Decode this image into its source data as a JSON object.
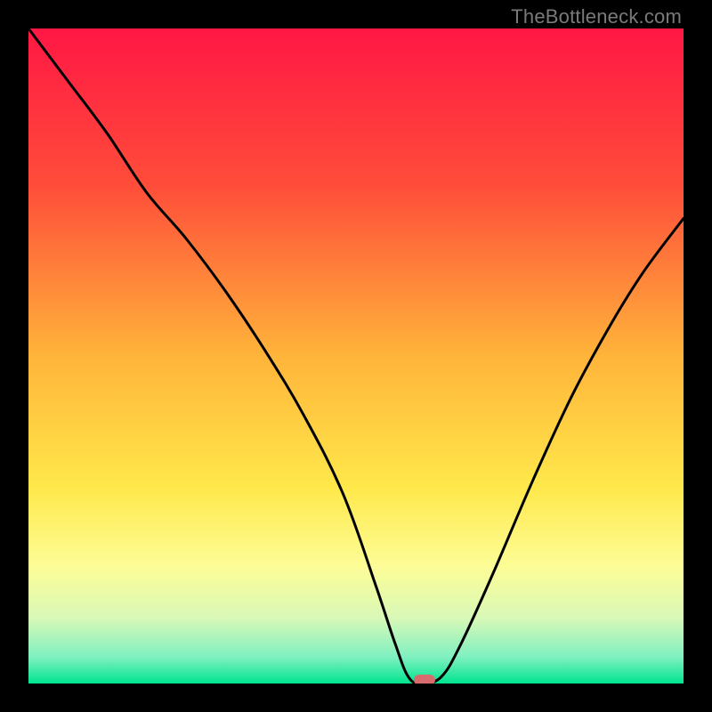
{
  "watermark": "TheBottleneck.com",
  "chart_data": {
    "type": "line",
    "title": "",
    "xlabel": "",
    "ylabel": "",
    "xlim": [
      0,
      100
    ],
    "ylim": [
      0,
      100
    ],
    "gradient_stops": [
      {
        "offset": 0,
        "color": "#ff1744"
      },
      {
        "offset": 0.24,
        "color": "#ff4d3a"
      },
      {
        "offset": 0.5,
        "color": "#ffb43a"
      },
      {
        "offset": 0.7,
        "color": "#ffe84a"
      },
      {
        "offset": 0.82,
        "color": "#fdfd96"
      },
      {
        "offset": 0.9,
        "color": "#d9f8b7"
      },
      {
        "offset": 0.96,
        "color": "#7ef0c0"
      },
      {
        "offset": 1.0,
        "color": "#00e58f"
      }
    ],
    "series": [
      {
        "name": "bottleneck-curve",
        "x": [
          0,
          6,
          12,
          18,
          24,
          30,
          36,
          42,
          48,
          53,
          56,
          58,
          60,
          63,
          66,
          71,
          77,
          83,
          89,
          94,
          100
        ],
        "y": [
          100,
          92,
          84,
          75,
          68,
          60,
          51,
          41,
          29,
          15,
          6,
          1,
          0,
          1,
          6,
          17,
          31,
          44,
          55,
          63,
          71
        ]
      }
    ],
    "marker": {
      "x": 60.5,
      "y": 0.5,
      "color": "#d86b6e"
    },
    "annotations": []
  }
}
